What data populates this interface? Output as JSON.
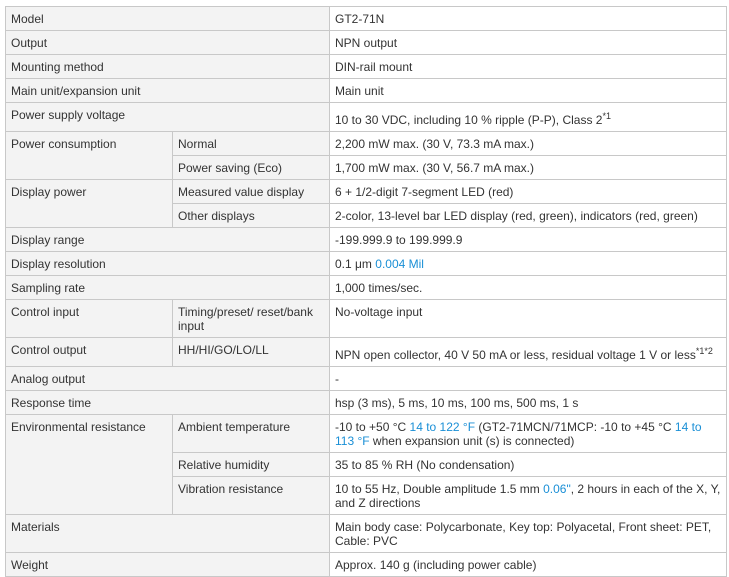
{
  "rows": {
    "model": {
      "label": "Model",
      "value": "GT2-71N"
    },
    "output": {
      "label": "Output",
      "value": "NPN output"
    },
    "mounting": {
      "label": "Mounting method",
      "value": "DIN-rail mount"
    },
    "unit": {
      "label": "Main unit/expansion unit",
      "value": "Main unit"
    },
    "power_supply": {
      "label": "Power supply voltage",
      "value": "10 to 30 VDC, including 10 % ripple (P-P), Class 2",
      "note": "*1"
    },
    "power_consumption": {
      "label": "Power consumption",
      "normal": {
        "label": "Normal",
        "value": "2,200 mW max. (30 V, 73.3 mA max.)"
      },
      "saving": {
        "label": "Power saving (Eco)",
        "value": "1,700 mW max. (30 V, 56.7 mA max.)"
      }
    },
    "display_power": {
      "label": "Display power",
      "measured": {
        "label": "Measured value display",
        "value": "6 + 1/2-digit 7-segment LED (red)"
      },
      "other": {
        "label": "Other displays",
        "value": "2-color, 13-level bar LED display (red, green), indicators (red, green)"
      }
    },
    "display_range": {
      "label": "Display range",
      "value": "-199.999.9 to 199.999.9"
    },
    "display_resolution": {
      "label": "Display resolution",
      "value": "0.1 μm",
      "value_alt": "0.004 Mil"
    },
    "sampling": {
      "label": "Sampling rate",
      "value": "1,000 times/sec."
    },
    "control_input": {
      "label": "Control input",
      "sub_label": "Timing/preset/ reset/bank input",
      "value": "No-voltage input"
    },
    "control_output": {
      "label": "Control output",
      "sub_label": "HH/HI/GO/LO/LL",
      "value": "NPN open collector, 40 V 50 mA or less, residual voltage 1 V or less",
      "note": "*1*2"
    },
    "analog_output": {
      "label": "Analog output",
      "value": "-"
    },
    "response_time": {
      "label": "Response time",
      "value": "hsp (3 ms), 5 ms, 10 ms, 100 ms, 500 ms, 1 s"
    },
    "environmental": {
      "label": "Environmental resistance",
      "ambient": {
        "label": "Ambient temperature",
        "v1": "-10 to +50 °C ",
        "v1_alt": "14 to 122 °F",
        "v2": " (GT2-71MCN/71MCP: -10 to +45 °C ",
        "v2_alt": "14 to 113 °F",
        "v3": " when expansion unit (s) is connected)"
      },
      "humidity": {
        "label": "Relative humidity",
        "value": "35 to 85 % RH (No condensation)"
      },
      "vibration": {
        "label": "Vibration resistance",
        "v1": "10 to 55 Hz, Double amplitude 1.5 mm ",
        "v1_alt": "0.06\"",
        "v2": ", 2 hours in each of the X, Y, and Z directions"
      }
    },
    "materials": {
      "label": "Materials",
      "value": "Main body case: Polycarbonate, Key top: Polyacetal, Front sheet: PET, Cable: PVC"
    },
    "weight": {
      "label": "Weight",
      "value": "Approx. 140 g (including power cable)"
    }
  }
}
